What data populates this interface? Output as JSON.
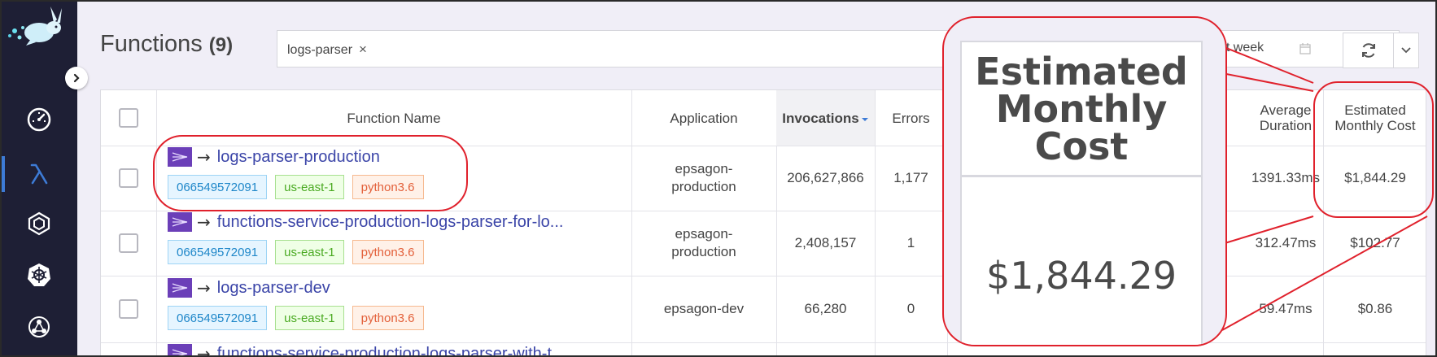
{
  "page": {
    "title": "Functions",
    "count": "(9)"
  },
  "filter": {
    "chip": "logs-parser",
    "chip_close": "×",
    "date_range": "ast week"
  },
  "columns": {
    "function_name": "Function Name",
    "application": "Application",
    "invocations": "Invocations",
    "errors": "Errors",
    "avg_duration": "Average Duration",
    "est_cost": "Estimated Monthly Cost"
  },
  "rows": [
    {
      "name": "logs-parser-production",
      "account": "066549572091",
      "region": "us-east-1",
      "runtime": "python3.6",
      "application": "epsagon-production",
      "invocations": "206,627,866",
      "errors": "1,177",
      "avg_duration": "1391.33ms",
      "cost": "$1,844.29"
    },
    {
      "name": "functions-service-production-logs-parser-for-lo...",
      "account": "066549572091",
      "region": "us-east-1",
      "runtime": "python3.6",
      "application": "epsagon-production",
      "invocations": "2,408,157",
      "errors": "1",
      "avg_duration": "312.47ms",
      "cost": "$102.77"
    },
    {
      "name": "logs-parser-dev",
      "account": "066549572091",
      "region": "us-east-1",
      "runtime": "python3.6",
      "application": "epsagon-dev",
      "invocations": "66,280",
      "errors": "0",
      "avg_duration": "59.47ms",
      "cost": "$0.86"
    },
    {
      "name": "functions-service-production-logs-parser-with-t"
    }
  ],
  "zoom": {
    "header": "Estimated Monthly Cost",
    "value": "$1,844.29"
  },
  "colors": {
    "sidebar": "#1e1f35",
    "accent_red": "#e0212c",
    "link": "#3b45a8",
    "function_icon": "#6b3fb8"
  },
  "icons": {
    "logo": "rabbit-logo-icon",
    "nav": [
      "dashboard-gauge-icon",
      "lambda-icon",
      "hexagon-icon",
      "kubernetes-icon",
      "tracing-icon"
    ],
    "collapse": "chevron-right-icon",
    "calendar": "calendar-icon",
    "refresh": "refresh-icon",
    "caret": "chevron-down-icon",
    "sort": "sort-desc-icon",
    "link_arrow": "arrow-right-icon"
  }
}
